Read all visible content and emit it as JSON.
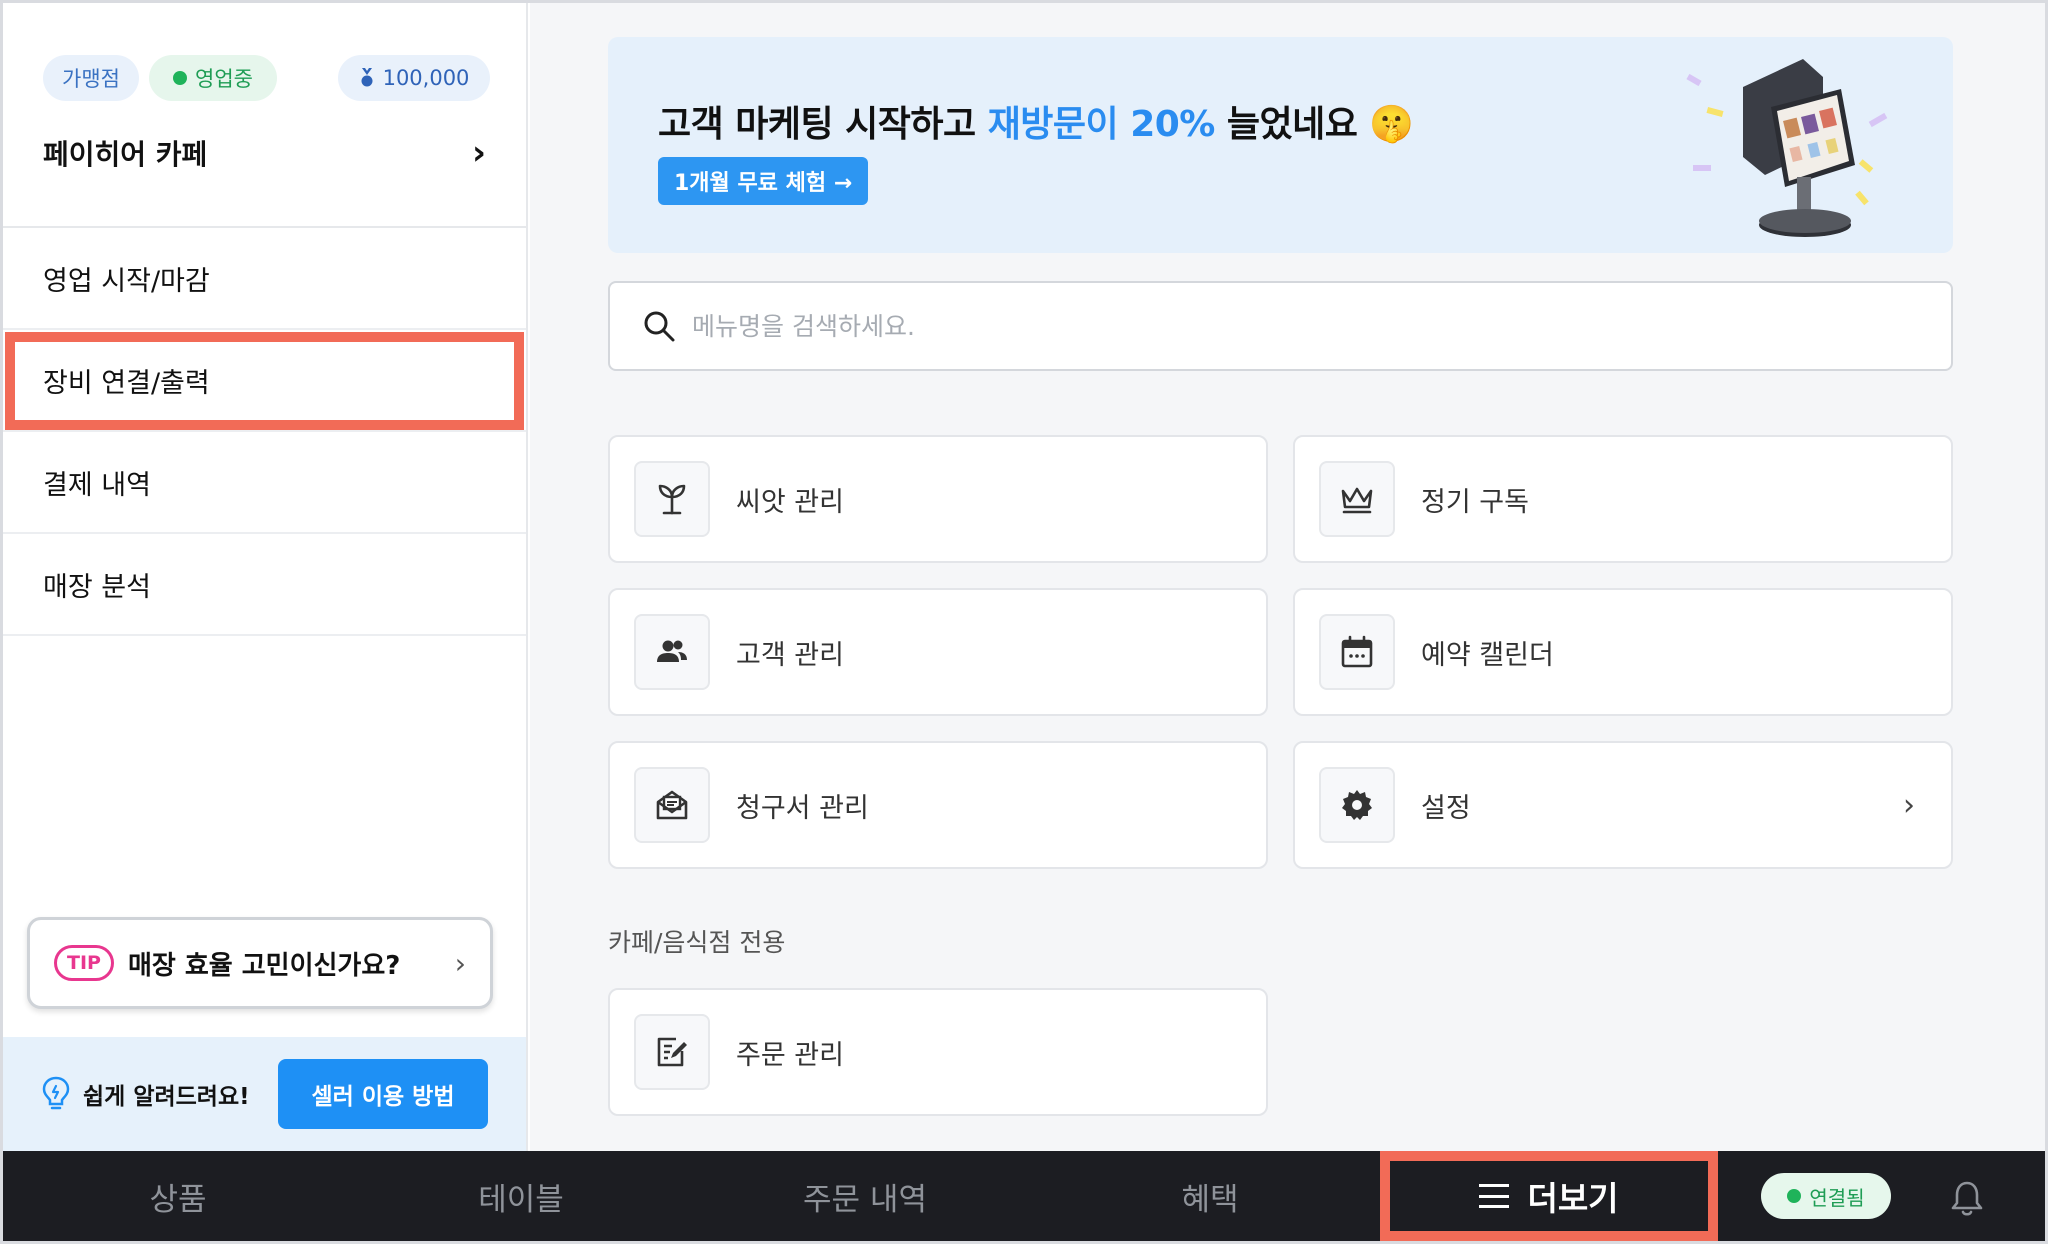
{
  "sidebar": {
    "badges": {
      "franchise": "가맹점",
      "open_status": "영업중",
      "points": "100,000"
    },
    "store_name": "페이히어 카페",
    "menu": [
      {
        "label": "영업 시작/마감"
      },
      {
        "label": "장비 연결/출력"
      },
      {
        "label": "결제 내역"
      },
      {
        "label": "매장 분석"
      }
    ],
    "tip": {
      "badge": "TIP",
      "text": "매장 효율 고민이신가요?"
    },
    "help": {
      "text": "쉽게 알려드려요!",
      "button": "셀러 이용 방법"
    }
  },
  "banner": {
    "title_prefix": "고객 마케팅 시작하고 ",
    "title_accent": "재방문이 20%",
    "title_suffix": " 늘었네요 🤫",
    "cta": "1개월 무료 체험 →"
  },
  "search": {
    "placeholder": "메뉴명을 검색하세요."
  },
  "cards": {
    "seed": {
      "label": "씨앗 관리",
      "icon": "sprout-icon"
    },
    "subscription": {
      "label": "정기 구독",
      "icon": "crown-icon"
    },
    "customer": {
      "label": "고객 관리",
      "icon": "people-icon"
    },
    "reservation": {
      "label": "예약 캘린더",
      "icon": "calendar-icon"
    },
    "invoice": {
      "label": "청구서 관리",
      "icon": "invoice-envelope-icon"
    },
    "settings": {
      "label": "설정",
      "icon": "gear-icon"
    }
  },
  "section": {
    "label": "카페/음식점 전용",
    "cards": {
      "order": {
        "label": "주문 관리",
        "icon": "order-edit-icon"
      }
    }
  },
  "bottom_nav": {
    "items": [
      {
        "label": "상품"
      },
      {
        "label": "테이블"
      },
      {
        "label": "주문 내역"
      },
      {
        "label": "혜택"
      }
    ],
    "more": "더보기",
    "status": "연결됨"
  },
  "colors": {
    "accent_blue": "#2a8cf0",
    "highlight_red": "#f26b57",
    "status_green": "#1fb35a",
    "nav_bg": "#1c1d22"
  }
}
